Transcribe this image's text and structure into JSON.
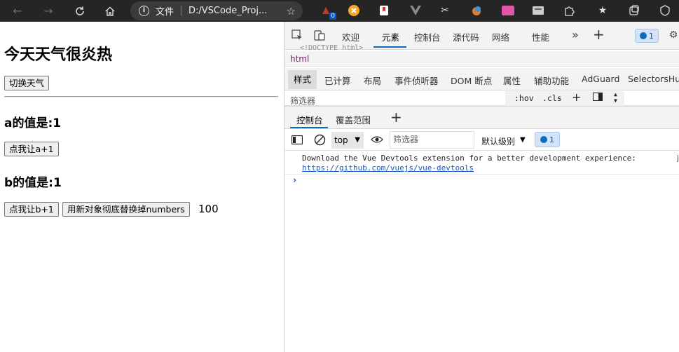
{
  "browser": {
    "protocol_label": "文件",
    "url": "D:/VSCode_Proj...",
    "ext_badge": "0"
  },
  "page": {
    "title": "今天天气很炎热",
    "toggle_button": "切换天气",
    "a_heading": "a的值是:1",
    "a_button": "点我让a+1",
    "b_heading": "b的值是:1",
    "b_button": "点我让b+1",
    "replace_button": "用新对象彻底替换掉numbers",
    "number_text": "100"
  },
  "devtools": {
    "tabs": [
      "欢迎",
      "元素",
      "控制台",
      "源代码",
      "网络",
      "性能"
    ],
    "active_tab": "元素",
    "issues_count": "1",
    "faded_doctype": "<!DOCTYPE html>",
    "breadcrumb": "html",
    "sub_tabs": [
      "样式",
      "已计算",
      "布局",
      "事件侦听器",
      "DOM 断点",
      "属性",
      "辅助功能",
      "AdGuard",
      "SelectorsHub"
    ],
    "filter_placeholder": "筛选器",
    "hov_label": ":hov",
    "cls_label": ".cls",
    "drawer_tabs": [
      "控制台",
      "覆盖范围"
    ],
    "context_select": "top",
    "console_filter_placeholder": "筛选器",
    "log_level": "默认级别",
    "console_issue_count": "1",
    "message_text": "Download the Vue Devtools extension for a better development experience:",
    "message_link": "https://github.com/vuejs/vue-devtools",
    "message_fragment": "j"
  }
}
